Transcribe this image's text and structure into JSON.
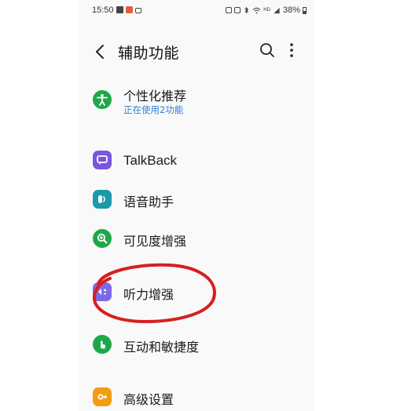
{
  "status_bar": {
    "time": "15:50",
    "battery": "38%",
    "network": "HD"
  },
  "header": {
    "title": "辅助功能"
  },
  "items": [
    {
      "label": "个性化推荐",
      "sublabel": "正在使用2功能",
      "icon": "accessibility-person-icon",
      "color": "#1ea84a"
    },
    {
      "label": "TalkBack",
      "icon": "talkback-icon",
      "color": "#7a55e0"
    },
    {
      "label": "语音助手",
      "icon": "voice-assistant-icon",
      "color": "#1a9aa8"
    },
    {
      "label": "可见度增强",
      "icon": "visibility-zoom-icon",
      "color": "#1ea84a"
    },
    {
      "label": "听力增强",
      "icon": "hearing-enhance-icon",
      "color": "#7a6ae8"
    },
    {
      "label": "互动和敏捷度",
      "icon": "interaction-hand-icon",
      "color": "#1ea84a"
    },
    {
      "label": "高级设置",
      "icon": "advanced-settings-icon",
      "color": "#f39c12"
    }
  ],
  "colors": {
    "accent_link": "#2f7fd8",
    "annotation_circle": "#d81e1e"
  }
}
